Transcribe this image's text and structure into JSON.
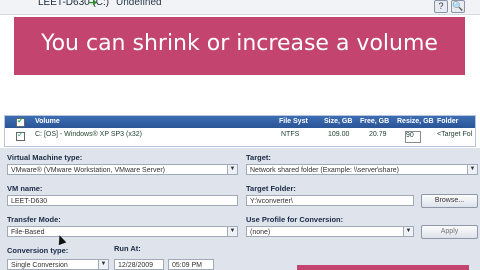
{
  "topbar": {
    "drive": "LEET-D630 (C:)",
    "arrow": "➜",
    "status": "Undefined",
    "help_icon": "?",
    "search_icon": "🔍"
  },
  "banner": {
    "text": "You can shrink or increase a volume"
  },
  "grid": {
    "headers": {
      "volume": "Volume",
      "filesys": "File Syst",
      "size": "Size, GB",
      "free": "Free, GB",
      "resize": "Resize, GB",
      "folder": "Folder"
    },
    "row": {
      "name": "C:  [OS] - Windows® XP SP3 (x32)",
      "filesys": "NTFS",
      "size": "109.00",
      "free": "20.79",
      "resize": "90",
      "folder": "<Target Fol"
    }
  },
  "form": {
    "vm_type_label": "Virtual Machine type:",
    "vm_type_value": "VMware® (VMware Workstation, VMware Server)",
    "target_label": "Target:",
    "target_value": "Network shared folder (Example: \\\\server\\share)",
    "vmname_label": "VM name:",
    "vmname_value": "LEET-D630",
    "target_folder_label": "Target Folder:",
    "target_folder_value": "Y:\\vconverter\\",
    "browse_label": "Browse...",
    "transfer_mode_label": "Transfer Mode:",
    "transfer_mode_value": "File-Based",
    "use_profile_label": "Use Profile for Conversion:",
    "use_profile_value": "(none)",
    "apply_label": "Apply",
    "conversion_type_label": "Conversion type:",
    "conversion_type_value": "Single Conversion",
    "run_at_label": "Run At:",
    "run_date_value": "12/28/2009",
    "run_time_value": "05:09 PM"
  },
  "colors": {
    "banner": "#c3446e",
    "header": "#2a5596"
  }
}
